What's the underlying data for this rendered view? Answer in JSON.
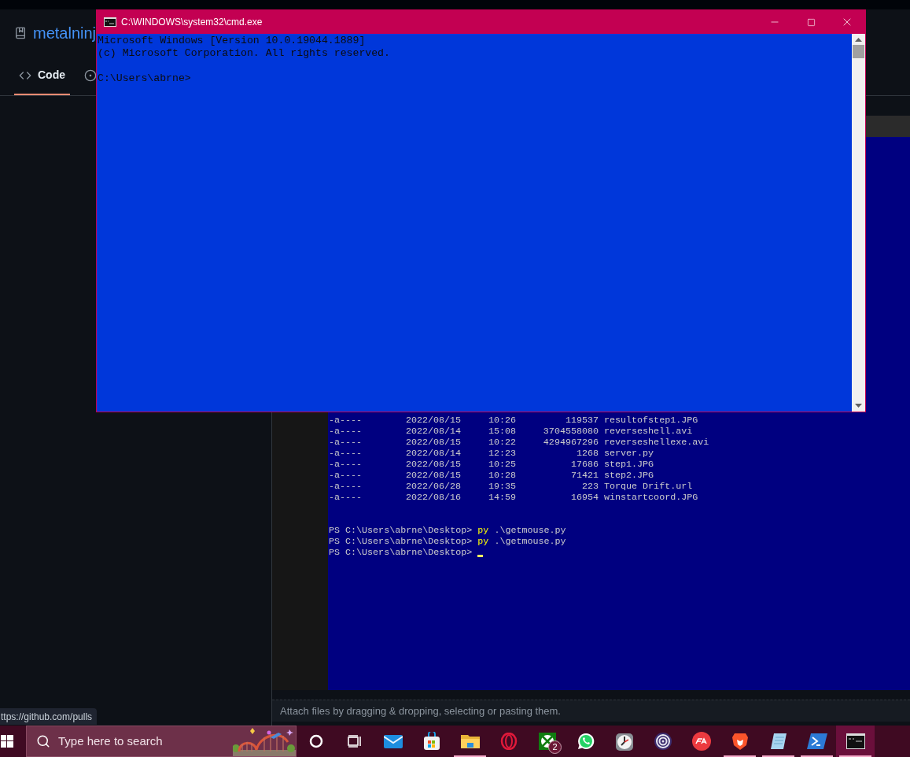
{
  "browser_page": {
    "repo_name": "metalninj",
    "tabs": [
      {
        "label": "Code",
        "selected": true
      },
      {
        "selected": false
      }
    ],
    "attach_hint": "Attach files by dragging & dropping, selecting or pasting them.",
    "status_url": "ttps://github.com/pulls"
  },
  "powershell": {
    "rows": [
      {
        "mode": "-a----",
        "date": "2022/08/15",
        "time": "10:26",
        "length": "119537",
        "name": "resultofstep1.JPG"
      },
      {
        "mode": "-a----",
        "date": "2022/08/14",
        "time": "15:08",
        "length": "3704558080",
        "name": "reverseshell.avi"
      },
      {
        "mode": "-a----",
        "date": "2022/08/15",
        "time": "10:22",
        "length": "4294967296",
        "name": "reverseshellexe.avi"
      },
      {
        "mode": "-a----",
        "date": "2022/08/14",
        "time": "12:23",
        "length": "1268",
        "name": "server.py"
      },
      {
        "mode": "-a----",
        "date": "2022/08/15",
        "time": "10:25",
        "length": "17686",
        "name": "step1.JPG"
      },
      {
        "mode": "-a----",
        "date": "2022/08/15",
        "time": "10:28",
        "length": "71421",
        "name": "step2.JPG"
      },
      {
        "mode": "-a----",
        "date": "2022/06/28",
        "time": "19:35",
        "length": "223",
        "name": "Torque Drift.url"
      },
      {
        "mode": "-a----",
        "date": "2022/08/16",
        "time": "14:59",
        "length": "16954",
        "name": "winstartcoord.JPG"
      }
    ],
    "prompts": [
      {
        "prompt": "PS C:\\Users\\abrne\\Desktop>",
        "command": "py",
        "args": ".\\getmouse.py",
        "cursor": false
      },
      {
        "prompt": "PS C:\\Users\\abrne\\Desktop>",
        "command": "py",
        "args": ".\\getmouse.py",
        "cursor": false
      },
      {
        "prompt": "PS C:\\Users\\abrne\\Desktop>",
        "cursor": true
      }
    ]
  },
  "cmd_window": {
    "title": "C:\\WINDOWS\\system32\\cmd.exe",
    "output": [
      "Microsoft Windows [Version 10.0.19044.1889]",
      "(c) Microsoft Corporation. All rights reserved."
    ],
    "prompt": "C:\\Users\\abrne>"
  },
  "taskbar": {
    "search_placeholder": "Type here to search",
    "apps": [
      {
        "kind": "cortana",
        "running": false,
        "selected": false
      },
      {
        "kind": "taskview",
        "running": false,
        "selected": false
      },
      {
        "kind": "mail",
        "running": false,
        "selected": false
      },
      {
        "kind": "store",
        "running": false,
        "selected": false
      },
      {
        "kind": "explorer",
        "running": true,
        "selected": false
      },
      {
        "kind": "opera",
        "running": false,
        "selected": false
      },
      {
        "kind": "xbox",
        "running": false,
        "selected": false,
        "badge": "2"
      },
      {
        "kind": "whatsapp",
        "running": false,
        "selected": false
      },
      {
        "kind": "clock",
        "running": false,
        "selected": false
      },
      {
        "kind": "swirl",
        "running": false,
        "selected": false
      },
      {
        "kind": "ea",
        "running": false,
        "selected": false
      },
      {
        "kind": "brave",
        "running": true,
        "selected": false
      },
      {
        "kind": "notepad",
        "running": true,
        "selected": false
      },
      {
        "kind": "powershell",
        "running": true,
        "selected": false
      },
      {
        "kind": "cmd",
        "running": true,
        "selected": true
      }
    ]
  }
}
